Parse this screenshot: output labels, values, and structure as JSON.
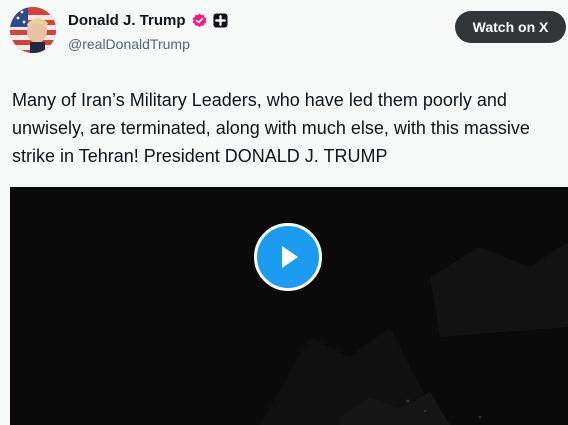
{
  "author": {
    "display_name": "Donald J. Trump",
    "handle": "@realDonaldTrump",
    "avatar_icon": "avatar-flag-portrait",
    "verified_badge_icon": "verified-badge-icon",
    "affiliation_badge_icon": "affiliation-badge-icon",
    "verified_color": "#f91880"
  },
  "actions": {
    "watch_label": "Watch on X"
  },
  "post": {
    "text": "Many of Iran’s Military Leaders, who have led them poorly and unwisely, are terminated, along with much else, with this massive strike in Tehran! President DONALD J. TRUMP"
  },
  "video": {
    "play_icon": "play-icon",
    "play_color": "#1d9bf0"
  }
}
